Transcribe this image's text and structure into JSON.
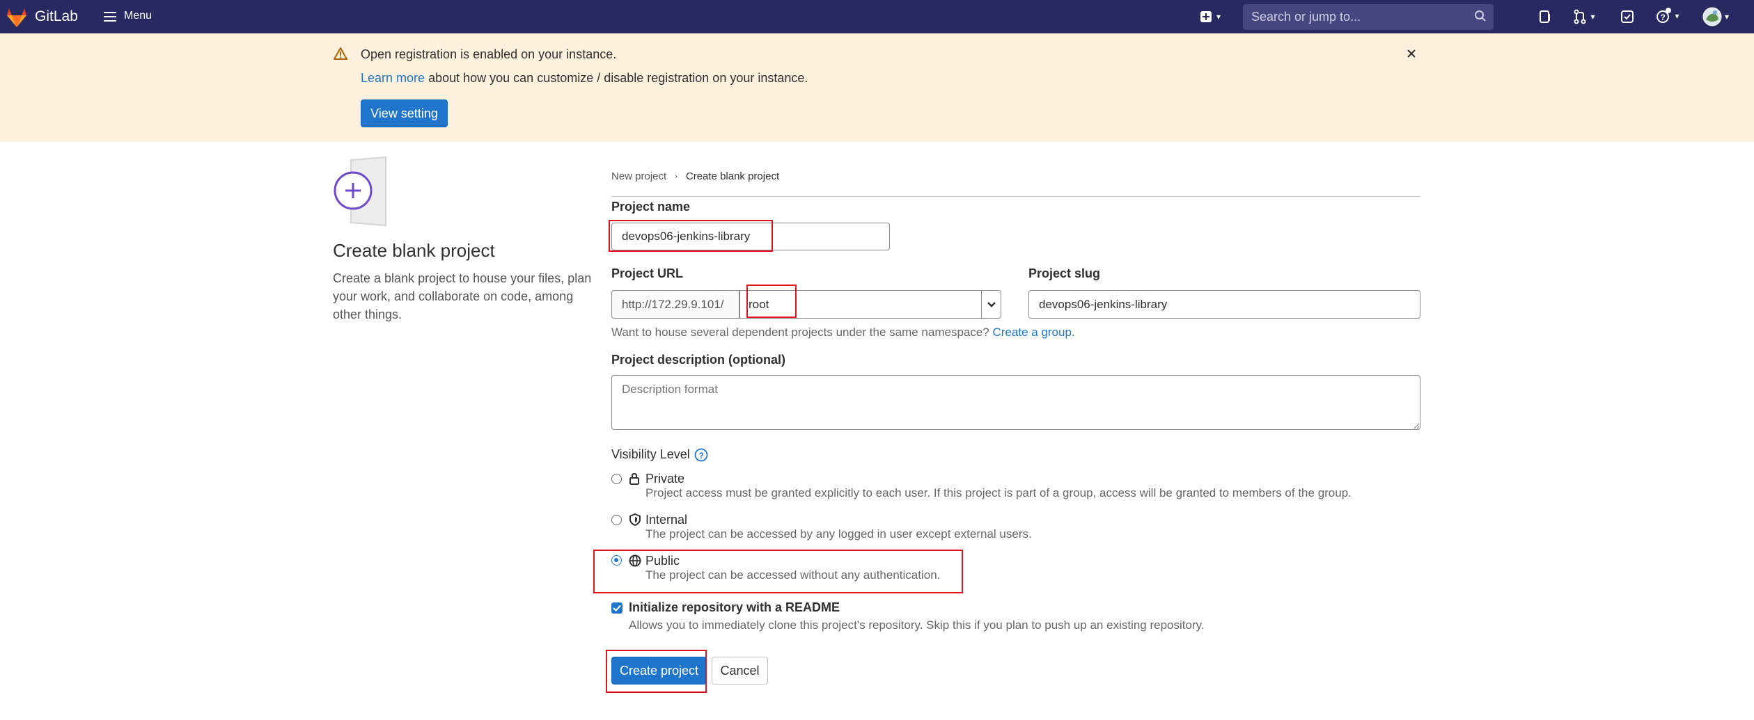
{
  "navbar": {
    "brand": "GitLab",
    "menu_label": "Menu",
    "search_placeholder": "Search or jump to..."
  },
  "banner": {
    "title": "Open registration is enabled on your instance.",
    "learn_more": "Learn more",
    "text_rest": "about how you can customize / disable registration on your instance.",
    "button": "View setting"
  },
  "sidebar": {
    "title": "Create blank project",
    "description": "Create a blank project to house your files, plan your work, and collaborate on code, among other things."
  },
  "breadcrumb": {
    "items": [
      "New project",
      "Create blank project"
    ]
  },
  "form": {
    "project_name_label": "Project name",
    "project_name_value": "devops06-jenkins-library",
    "project_url_label": "Project URL",
    "url_prefix": "http://172.29.9.101/",
    "namespace_value": "root",
    "project_slug_label": "Project slug",
    "project_slug_value": "devops06-jenkins-library",
    "namespace_help": "Want to house several dependent projects under the same namespace?",
    "create_group_link": "Create a group.",
    "description_label": "Project description (optional)",
    "description_placeholder": "Description format",
    "visibility_label": "Visibility Level",
    "visibility_options": [
      {
        "title": "Private",
        "description": "Project access must be granted explicitly to each user. If this project is part of a group, access will be granted to members of the group.",
        "icon": "lock-icon",
        "checked": false
      },
      {
        "title": "Internal",
        "description": "The project can be accessed by any logged in user except external users.",
        "icon": "shield-icon",
        "checked": false
      },
      {
        "title": "Public",
        "description": "The project can be accessed without any authentication.",
        "icon": "globe-icon",
        "checked": true
      }
    ],
    "readme_label": "Initialize repository with a README",
    "readme_description": "Allows you to immediately clone this project's repository. Skip this if you plan to push up an existing repository.",
    "readme_checked": true,
    "create_button": "Create project",
    "cancel_button": "Cancel"
  },
  "colors": {
    "navbar": "#292961",
    "banner": "#fdf1dd",
    "primary": "#1f75cb",
    "highlight": "#e0141e"
  }
}
